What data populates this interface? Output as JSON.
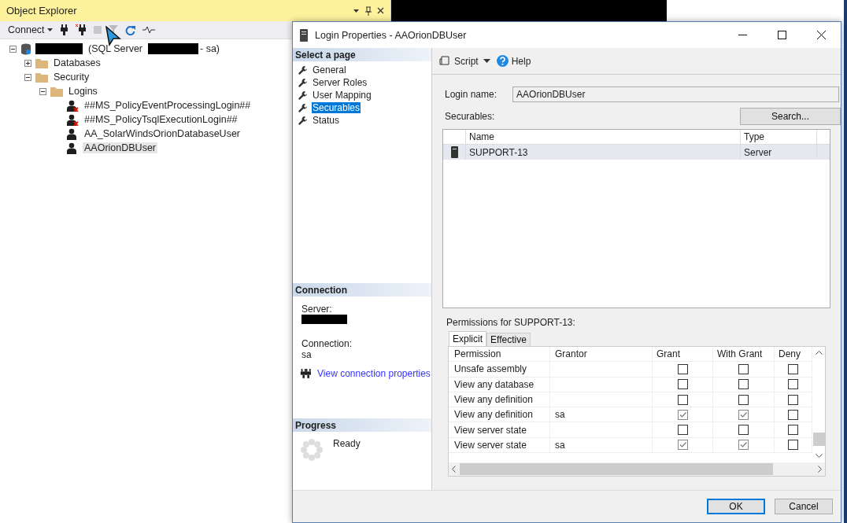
{
  "object_explorer": {
    "title": "Object Explorer",
    "toolbar": {
      "connect": "Connect"
    },
    "tree": [
      {
        "kind": "server",
        "label_start": "(SQL Server",
        "label_end": "- sa)",
        "expanded": true,
        "selected": false,
        "children": [
          {
            "kind": "folder",
            "label": "Databases",
            "expanded": false,
            "selected": false
          },
          {
            "kind": "folder",
            "label": "Security",
            "expanded": true,
            "selected": false,
            "children": [
              {
                "kind": "folder",
                "label": "Logins",
                "expanded": true,
                "selected": false,
                "children": [
                  {
                    "kind": "login",
                    "label": "##MS_PolicyEventProcessingLogin##",
                    "disabled": true,
                    "selected": false
                  },
                  {
                    "kind": "login",
                    "label": "##MS_PolicyTsqlExecutionLogin##",
                    "disabled": true,
                    "selected": false
                  },
                  {
                    "kind": "login",
                    "label": "AA_SolarWindsOrionDatabaseUser",
                    "disabled": false,
                    "selected": false
                  },
                  {
                    "kind": "login",
                    "label": "AAOrionDBUser",
                    "disabled": false,
                    "selected": true
                  }
                ]
              }
            ]
          }
        ]
      }
    ]
  },
  "dialog": {
    "title": "Login Properties - AAOrionDBUser",
    "select_page": {
      "heading": "Select a page",
      "items": [
        {
          "label": "General",
          "selected": false
        },
        {
          "label": "Server Roles",
          "selected": false
        },
        {
          "label": "User Mapping",
          "selected": false
        },
        {
          "label": "Securables",
          "selected": true
        },
        {
          "label": "Status",
          "selected": false
        }
      ]
    },
    "connection": {
      "heading": "Connection",
      "server_label": "Server:",
      "connection_label": "Connection:",
      "connection_value": "sa",
      "link": "View connection properties"
    },
    "progress": {
      "heading": "Progress",
      "status": "Ready"
    },
    "toolbar": {
      "script": "Script",
      "help": "Help"
    },
    "login_name": {
      "label": "Login name:",
      "value": "AAOrionDBUser"
    },
    "securables": {
      "label": "Securables:",
      "search_button": "Search...",
      "columns": [
        "Name",
        "Type"
      ],
      "rows": [
        {
          "name": "SUPPORT-13",
          "type": "Server",
          "selected": true
        }
      ]
    },
    "permissions": {
      "label": "Permissions for SUPPORT-13:",
      "tabs": [
        {
          "label": "Explicit",
          "selected": true
        },
        {
          "label": "Effective",
          "selected": false
        }
      ],
      "columns": [
        "Permission",
        "Grantor",
        "Grant",
        "With Grant",
        "Deny"
      ],
      "rows": [
        {
          "permission": "Unsafe assembly",
          "grant": false,
          "with_grant": false,
          "deny": false
        },
        {
          "permission": "View any database",
          "grant": false,
          "with_grant": false,
          "deny": false
        },
        {
          "permission": "View any definition",
          "grant": false,
          "with_grant": false,
          "deny": false
        },
        {
          "permission": "View any definition",
          "grantor": "sa",
          "grant": true,
          "with_grant": true,
          "deny": false
        },
        {
          "permission": "View server state",
          "grant": false,
          "with_grant": false,
          "deny": false
        },
        {
          "permission": "View server state",
          "grantor": "sa",
          "grant": true,
          "with_grant": true,
          "deny": false
        }
      ]
    },
    "buttons": [
      {
        "label": "OK",
        "default": true
      },
      {
        "label": "Cancel",
        "default": false
      }
    ]
  }
}
